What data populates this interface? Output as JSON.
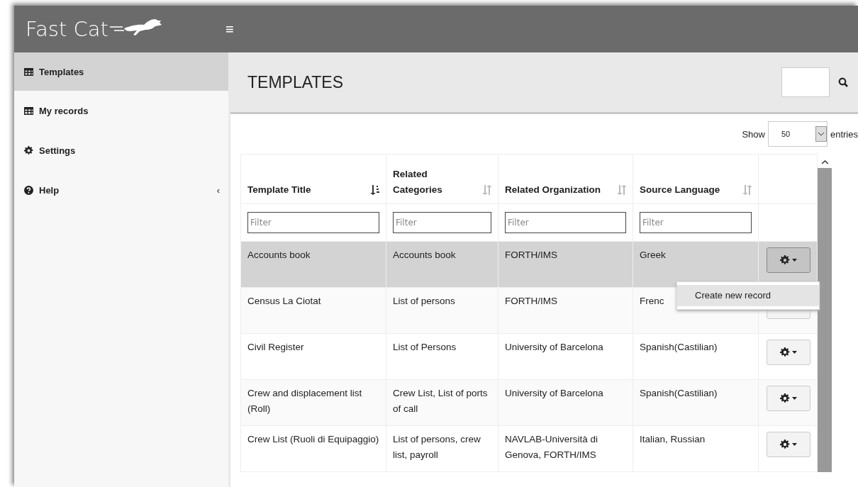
{
  "brand": {
    "name": "Fast Cat"
  },
  "menu_toggle": "≡",
  "sidebar": {
    "items": [
      {
        "label": "Templates",
        "kind": "table",
        "selected": true
      },
      {
        "label": "My records",
        "kind": "table",
        "selected": false
      },
      {
        "label": "Settings",
        "kind": "gear",
        "selected": false
      },
      {
        "label": "Help",
        "kind": "help",
        "selected": false,
        "collapse": "‹"
      }
    ]
  },
  "page": {
    "title": "TEMPLATES"
  },
  "length": {
    "before": "Show",
    "value": "50",
    "after": "entries"
  },
  "table": {
    "columns": [
      {
        "label": "Template Title",
        "sorted": true
      },
      {
        "label": "Related Categories",
        "sorted": false
      },
      {
        "label": "Related Organization",
        "sorted": false
      },
      {
        "label": "Source Language",
        "sorted": false
      }
    ],
    "filters": [
      {
        "placeholder": "Filter"
      },
      {
        "placeholder": "Filter"
      },
      {
        "placeholder": "Filter"
      },
      {
        "placeholder": "Filter"
      }
    ],
    "rows": [
      {
        "cells": [
          "Accounts book",
          "Accounts book",
          "FORTH/IMS",
          "Greek"
        ],
        "selected": true,
        "menu_open": true,
        "menu": [
          "Create new record"
        ]
      },
      {
        "cells": [
          "Census La Ciotat",
          "List of persons",
          "FORTH/IMS",
          "Frenc"
        ],
        "selected": false,
        "menu_open": false
      },
      {
        "cells": [
          "Civil Register",
          "List of Persons",
          "University of Barcelona",
          "Spanish(Castilian)"
        ],
        "selected": false,
        "menu_open": false
      },
      {
        "cells": [
          "Crew and displacement list (Roll)",
          "Crew List, List of ports of call",
          "University of Barcelona",
          "Spanish(Castilian)"
        ],
        "selected": false,
        "menu_open": false
      },
      {
        "cells": [
          "Crew List (Ruoli di Equipaggio)",
          "List of persons, crew list, payroll",
          "NAVLAB-Università di Genova, FORTH/IMS",
          "Italian, Russian"
        ],
        "selected": false,
        "menu_open": false
      }
    ]
  }
}
